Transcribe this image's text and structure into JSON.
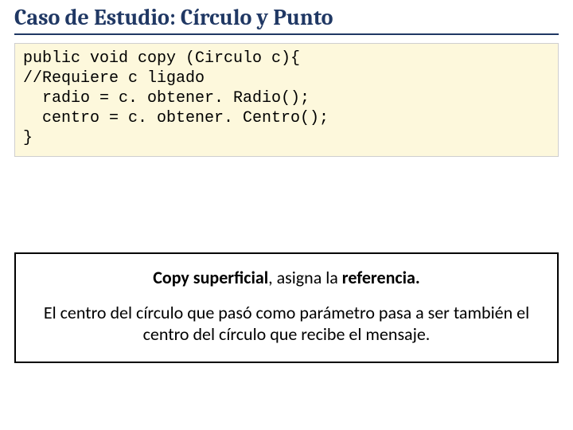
{
  "title": "Caso de Estudio: Círculo y Punto",
  "code": {
    "l1": "public void copy (Circulo c){",
    "l2": "//Requiere c ligado",
    "l3": "  radio = c. obtener. Radio();",
    "l4": "  centro = c. obtener. Centro();",
    "l5": "}"
  },
  "callout": {
    "head_b1": "Copy superficial",
    "head_t1": ", asigna la ",
    "head_b2": "referencia.",
    "body": "El centro del círculo que pasó como parámetro pasa a ser también el centro del círculo que recibe el mensaje."
  }
}
